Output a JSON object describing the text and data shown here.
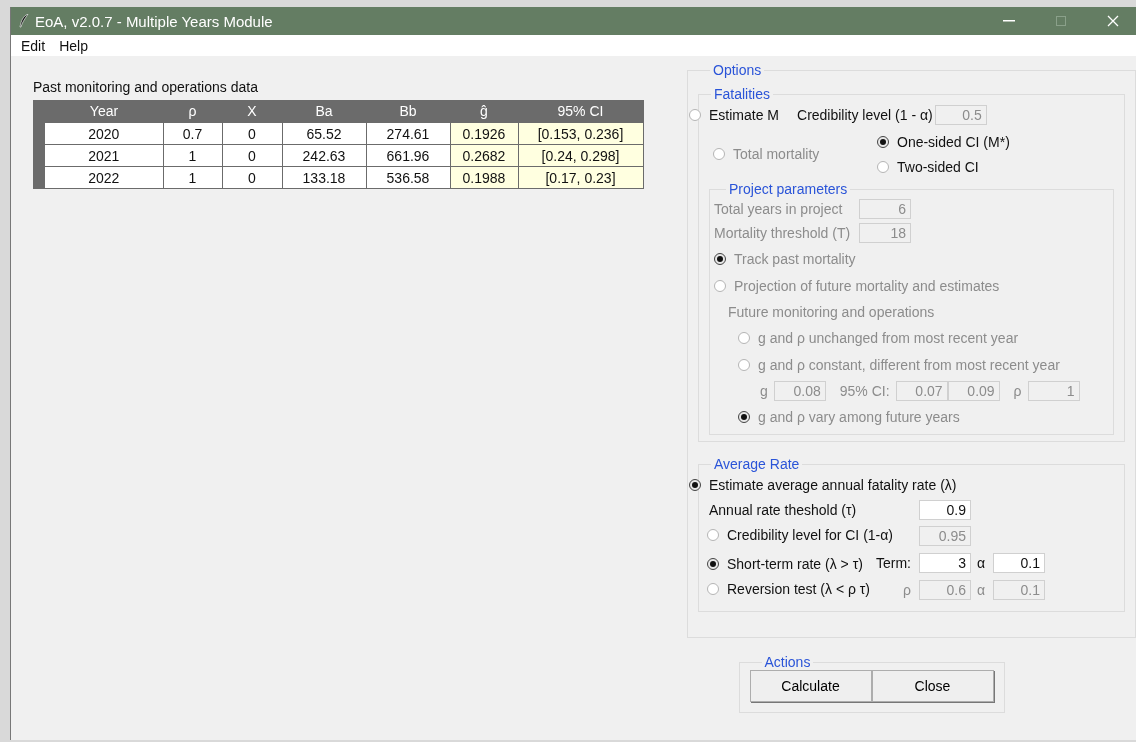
{
  "window": {
    "title": "EoA, v2.0.7 - Multiple Years Module"
  },
  "menu": [
    "Edit",
    "Help"
  ],
  "table": {
    "title": "Past monitoring and operations data",
    "columns": [
      {
        "label": "Year",
        "computed": false
      },
      {
        "label": "ρ",
        "computed": false
      },
      {
        "label": "X",
        "computed": false
      },
      {
        "label": "Ba",
        "computed": false
      },
      {
        "label": "Bb",
        "computed": false
      },
      {
        "label": "ĝ",
        "computed": true
      },
      {
        "label": "95% CI",
        "computed": true
      }
    ],
    "rows": [
      {
        "cells": [
          "2020",
          "0.7",
          "0",
          "65.52",
          "274.61",
          "0.1926",
          "[0.153, 0.236]"
        ]
      },
      {
        "cells": [
          "2021",
          "1",
          "0",
          "242.63",
          "661.96",
          "0.2682",
          "[0.24, 0.298]"
        ]
      },
      {
        "cells": [
          "2022",
          "1",
          "0",
          "133.18",
          "536.58",
          "0.1988",
          "[0.17, 0.23]"
        ]
      }
    ]
  },
  "options": {
    "title": "Options",
    "fatalities": {
      "title": "Fatalities",
      "estimate_m": {
        "label": "Estimate M",
        "selected": false,
        "disabled": false
      },
      "credibility": {
        "label": "Credibility level (1 - α)",
        "value": "0.5",
        "disabled": true
      },
      "total_mortality": {
        "label": "Total mortality",
        "selected": false,
        "disabled": true
      },
      "ci_options": [
        {
          "label": "One-sided CI (M*)",
          "selected": true,
          "disabled": false
        },
        {
          "label": "Two-sided CI",
          "selected": false,
          "disabled": false
        }
      ],
      "project": {
        "title": "Project parameters",
        "fields": [
          {
            "label": "Total years in project",
            "value": "6",
            "disabled": true
          },
          {
            "label": "Mortality threshold (T)",
            "value": "18",
            "disabled": true
          }
        ],
        "modes": [
          {
            "label": "Track past mortality",
            "selected": true,
            "disabled": true
          },
          {
            "label": "Projection of future mortality and estimates",
            "selected": false,
            "disabled": true
          }
        ],
        "future_title": "Future monitoring and operations",
        "future_options": [
          {
            "label": "g and ρ unchanged from most recent year",
            "selected": false,
            "disabled": true
          },
          {
            "label": "g and ρ constant, different from most recent year",
            "selected": false,
            "disabled": true
          },
          {
            "label": "g and ρ vary among future years",
            "selected": true,
            "disabled": true
          }
        ],
        "constant_fields": [
          {
            "prefix": "g",
            "value": "0.08",
            "disabled": true
          },
          {
            "prefix": "95% CI:",
            "value": "0.07",
            "disabled": true
          },
          {
            "value": "0.09",
            "disabled": true
          },
          {
            "prefix": "ρ",
            "value": "1",
            "disabled": true
          }
        ]
      }
    },
    "average_rate": {
      "title": "Average Rate",
      "estimate": {
        "label": "Estimate average annual fatality rate (λ)",
        "selected": true,
        "disabled": false
      },
      "threshold": {
        "label": "Annual rate theshold (τ)",
        "value": "0.9",
        "disabled": false
      },
      "choices": [
        {
          "label": "Credibility level for CI (1-α)",
          "selected": false,
          "disabled": false,
          "fields": [
            {
              "value": "0.95",
              "disabled": true
            }
          ]
        },
        {
          "label": "Short-term rate (λ > τ)",
          "selected": true,
          "disabled": false,
          "fields": [
            {
              "prefix": "Term:",
              "value": "3",
              "disabled": false
            },
            {
              "prefix": "α",
              "value": "0.1",
              "disabled": false
            }
          ]
        },
        {
          "label": "Reversion test (λ < ρ τ)",
          "selected": false,
          "disabled": false,
          "fields": [
            {
              "prefix": "ρ",
              "value": "0.6",
              "disabled": true
            },
            {
              "prefix": "α",
              "value": "0.1",
              "disabled": true
            }
          ]
        }
      ]
    }
  },
  "actions": {
    "title": "Actions",
    "buttons": [
      "Calculate",
      "Close"
    ]
  }
}
